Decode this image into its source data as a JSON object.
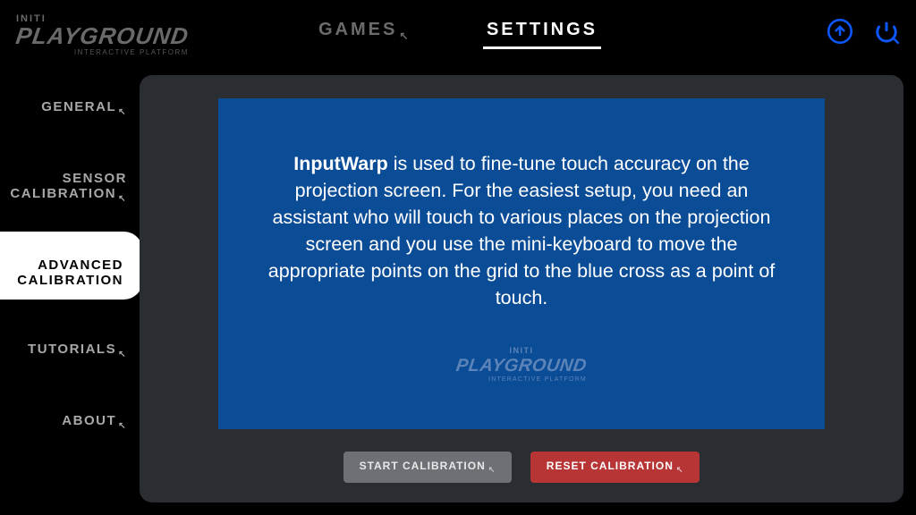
{
  "brand": {
    "top": "INITI",
    "main": "PLAYGROUND",
    "sub": "INTERACTIVE PLATFORM"
  },
  "topnav": {
    "games": "GAMES",
    "settings": "SETTINGS"
  },
  "sidenav": {
    "general": "GENERAL",
    "sensor": "SENSOR\nCALIBRATION",
    "advanced": "ADVANCED\nCALIBRATION",
    "tutorials": "TUTORIALS",
    "about": "ABOUT"
  },
  "info": {
    "strong": "InputWarp",
    "rest": " is used to fine-tune touch accuracy on the projection screen. For the easiest setup, you need an assistant who will touch to various places on the projection screen and you use the mini-keyboard to move the appropriate points on the grid to the blue cross as a point of touch."
  },
  "bluebrand": {
    "top": "INITI",
    "main": "PLAYGROUND",
    "sub": "INTERACTIVE PLATFORM"
  },
  "buttons": {
    "start": "START CALIBRATION",
    "reset": "RESET CALIBRATION"
  },
  "colors": {
    "accent_blue": "#0d57ff",
    "panel": "#2a2d32",
    "bluebox": "#0b4c97",
    "danger": "#b83535"
  }
}
